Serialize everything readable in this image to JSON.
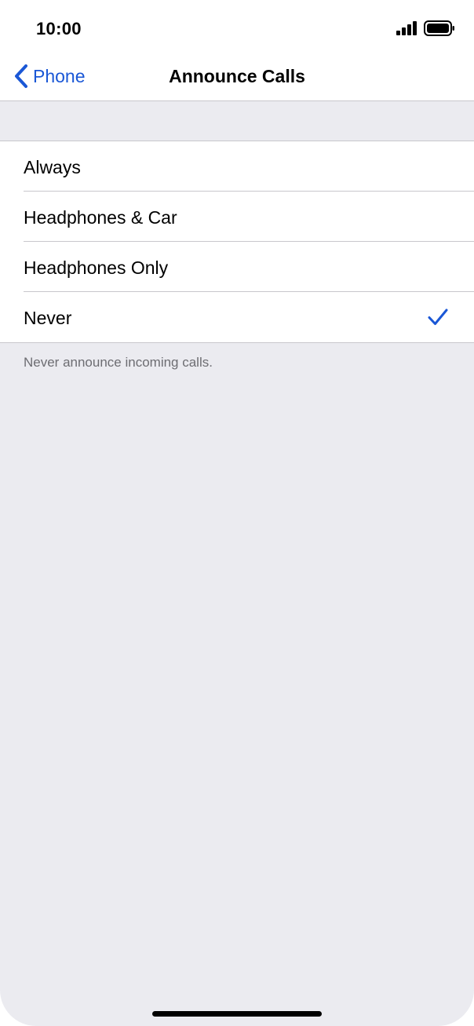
{
  "status_bar": {
    "time": "10:00",
    "icons": [
      "signal-icon",
      "battery-icon"
    ]
  },
  "nav": {
    "back_label": "Phone",
    "title": "Announce Calls",
    "back_icon": "chevron-left-icon"
  },
  "options": [
    {
      "label": "Always",
      "selected": false
    },
    {
      "label": "Headphones & Car",
      "selected": false
    },
    {
      "label": "Headphones Only",
      "selected": false
    },
    {
      "label": "Never",
      "selected": true
    }
  ],
  "footer": "Never announce incoming calls.",
  "colors": {
    "accent": "#1a57d6",
    "background": "#ebebf0",
    "separator": "#c8c7cc",
    "footer_text": "#6d6d72"
  }
}
